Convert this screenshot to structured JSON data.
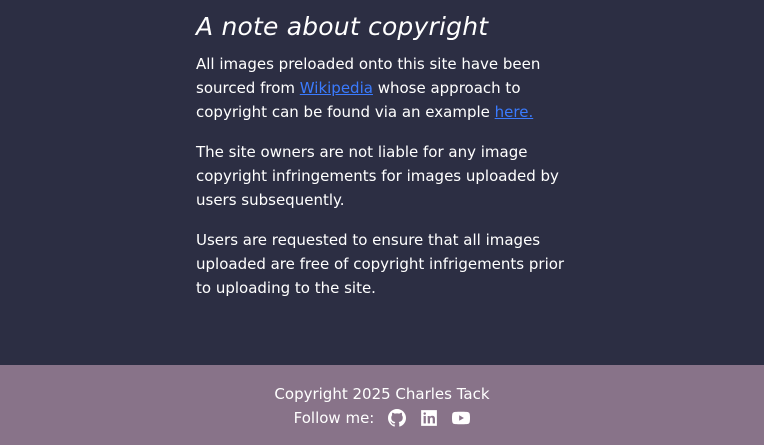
{
  "content": {
    "title": "A note about copyright",
    "para1": {
      "before_link": "All images preloaded onto this site have been sourced from ",
      "link1": "Wikipedia",
      "middle": " whose approach to copyright can be found via an example ",
      "link2": "here."
    },
    "para2": "The site owners are not liable for any image copyright infringements for images uploaded by users subsequently.",
    "para3": "Users are requested to ensure that all images uploaded are free of copyright infrigements prior to uploading to the site."
  },
  "footer": {
    "copyright": "Copyright 2025 Charles Tack",
    "follow_label": "Follow me:",
    "icons": [
      "github-icon",
      "linkedin-icon",
      "youtube-icon"
    ]
  },
  "colors": {
    "background": "#2c2e43",
    "footer_background": "#887389",
    "link": "#3a7bff"
  }
}
